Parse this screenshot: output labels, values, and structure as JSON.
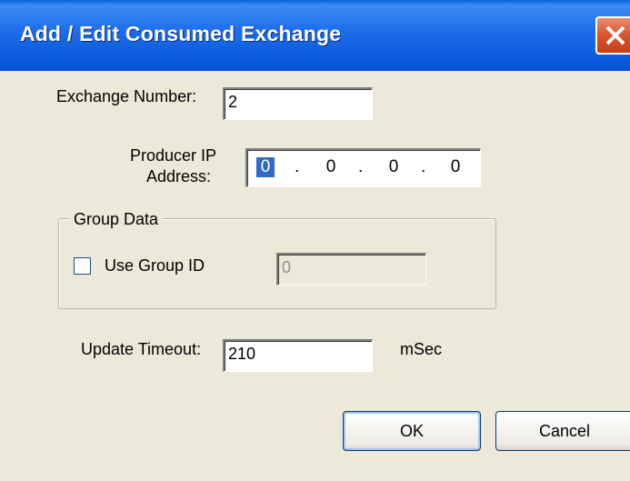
{
  "window": {
    "title": "Add / Edit Consumed Exchange",
    "close_label": "✕"
  },
  "exchange_number": {
    "label": "Exchange Number:",
    "value": "2"
  },
  "producer_ip": {
    "label_line1": "Producer IP",
    "label_line2": "Address:",
    "octets": [
      "0",
      "0",
      "0",
      "0"
    ],
    "separator": "."
  },
  "group_data": {
    "legend": "Group Data",
    "use_group_id_label": "Use Group ID",
    "use_group_id_checked": false,
    "group_id_value": "0"
  },
  "update_timeout": {
    "label": "Update Timeout:",
    "value": "210",
    "unit": "mSec"
  },
  "buttons": {
    "ok": "OK",
    "cancel": "Cancel"
  },
  "colors": {
    "titlebar": "#0452d6",
    "close": "#d9542c",
    "dialog_bg": "#ece9d8",
    "selection": "#316ac5"
  }
}
